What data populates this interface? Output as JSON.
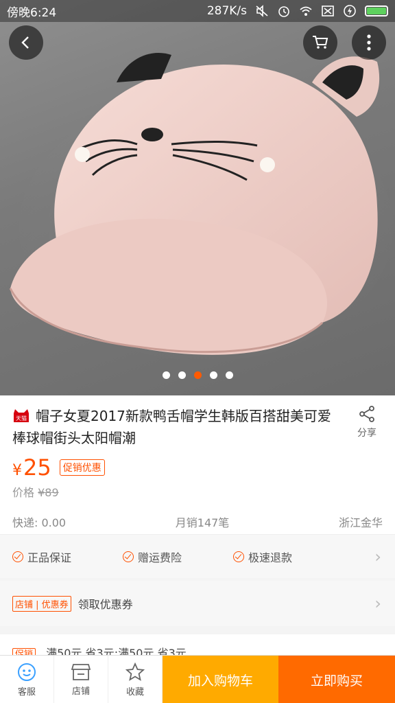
{
  "status_bar": {
    "time": "傍晚6:24",
    "speed": "287K/s",
    "icons": [
      "mute-icon",
      "alarm-icon",
      "wifi-icon",
      "sim-icon",
      "charging-icon",
      "battery-icon"
    ]
  },
  "header": {
    "back_icon": "back-arrow-icon",
    "cart_icon": "cart-icon",
    "more_icon": "more-vertical-icon"
  },
  "gallery": {
    "image_count": 5,
    "active_index": 2
  },
  "product": {
    "store_badge": "天猫",
    "title": "帽子女夏2017新款鸭舌帽学生韩版百搭甜美可爱棒球帽街头太阳帽潮",
    "share_label": "分享",
    "price_symbol": "¥",
    "price": "25",
    "promo_tag": "促销优惠",
    "original_label": "价格",
    "original_price": "¥89",
    "shipping": "快递: 0.00",
    "monthly_sales": "月销147笔",
    "location": "浙江金华"
  },
  "guarantees": [
    "正品保证",
    "赠运费险",
    "极速退款"
  ],
  "coupon": {
    "tag": "店铺 | 优惠券",
    "label": "领取优惠券"
  },
  "promotion": {
    "tag": "促销",
    "text": "满50元 省3元;满50元 省3元"
  },
  "bottom_bar": {
    "service": "客服",
    "store": "店铺",
    "favorite": "收藏",
    "add_to_cart": "加入购物车",
    "buy_now": "立即购买"
  },
  "colors": {
    "accent": "#ff5000",
    "cart_button": "#ffaa00",
    "buy_button": "#ff6a00"
  }
}
